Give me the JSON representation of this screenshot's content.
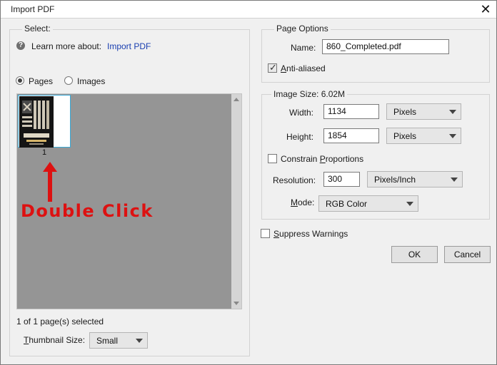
{
  "window": {
    "title": "Import PDF"
  },
  "select_group": {
    "label": "Select:",
    "learn_prefix": "Learn more about:",
    "learn_link": "Import PDF",
    "radio_pages": "Pages",
    "radio_images": "Images",
    "pages_selected": true,
    "thumb_page_number": "1",
    "annotation": "Double Click",
    "status": "1 of 1 page(s) selected",
    "thumb_size_label_first": "T",
    "thumb_size_label_rest": "humbnail Size:",
    "thumb_size_value": "Small"
  },
  "page_options": {
    "label": "Page Options",
    "name_label": "Name:",
    "name_value": "860_Completed.pdf",
    "anti_first": "A",
    "anti_rest": "nti-aliased",
    "anti_checked": true
  },
  "image_size": {
    "label": "Image Size: 6.02M",
    "width_label": "Width:",
    "width_value": "1134",
    "width_unit": "Pixels",
    "height_label": "Height:",
    "height_value": "1854",
    "height_unit": "Pixels",
    "constrain_pre": "Constrain ",
    "constrain_u": "P",
    "constrain_post": "roportions",
    "constrain_checked": false,
    "resolution_label": "Resolution:",
    "resolution_value": "300",
    "resolution_unit": "Pixels/Inch",
    "mode_first": "M",
    "mode_rest": "ode:",
    "mode_value": "RGB Color"
  },
  "suppress": {
    "first": "S",
    "rest": "uppress Warnings",
    "checked": false
  },
  "buttons": {
    "ok": "OK",
    "cancel": "Cancel"
  },
  "colors": {
    "annotation": "#dd1111",
    "thumb_border": "#39a9d6",
    "link": "#1a3fb0"
  }
}
